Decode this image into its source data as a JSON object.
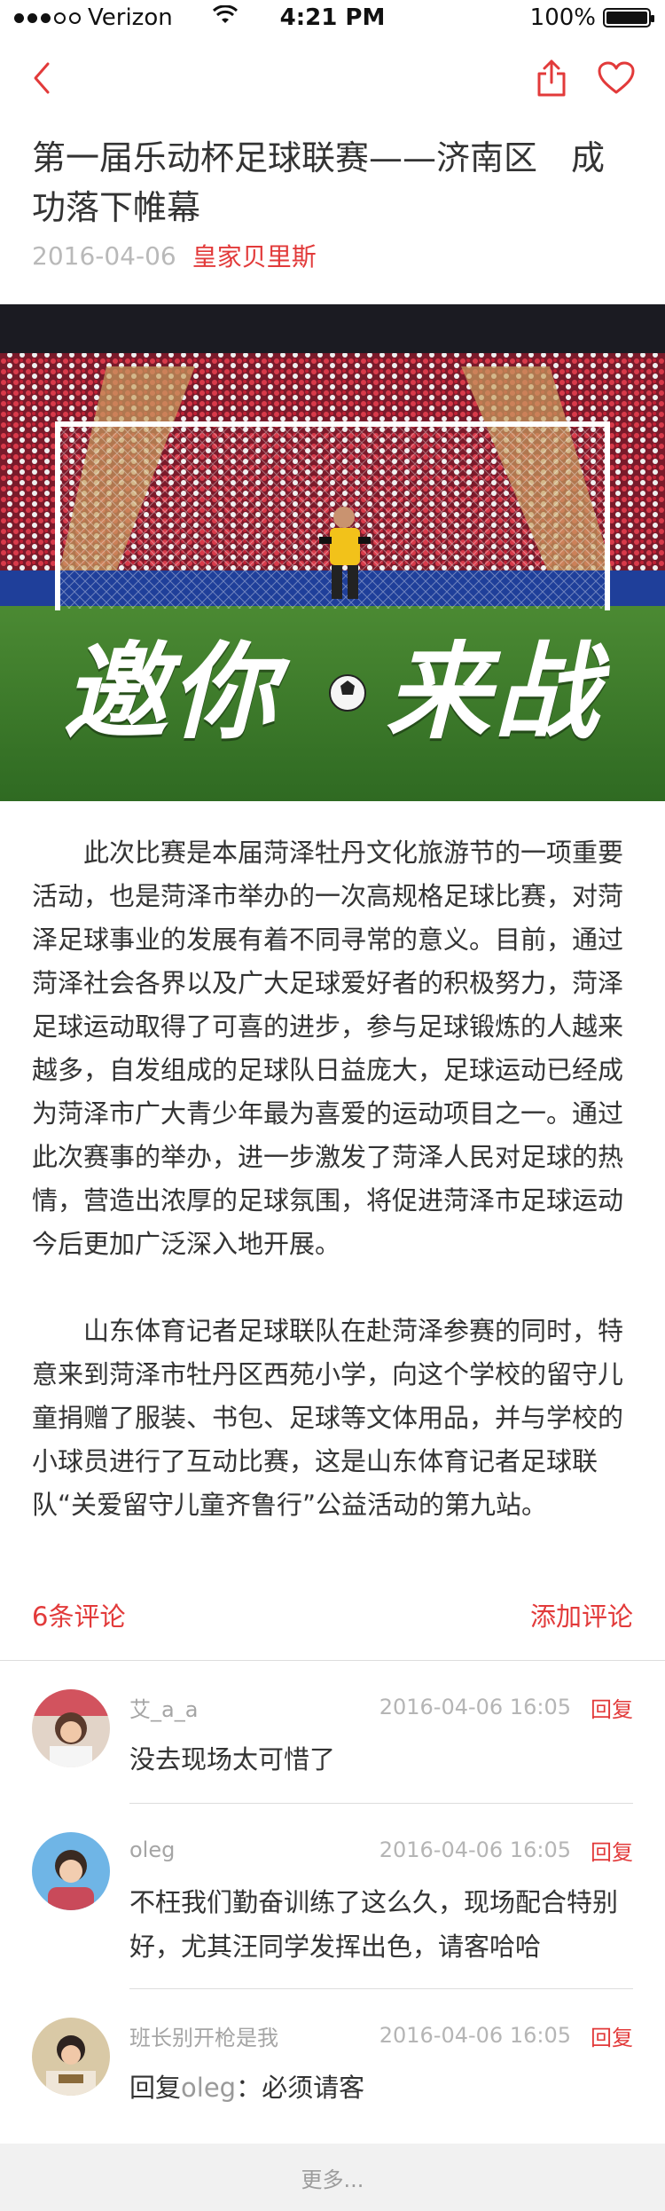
{
  "status_bar": {
    "carrier": "Verizon",
    "time": "4:21 PM",
    "battery": "100%"
  },
  "nav": {
    "back_icon": "chevron-left-icon",
    "share_icon": "share-icon",
    "like_icon": "heart-icon"
  },
  "article": {
    "title": "第一届乐动杯足球联赛——济南区　成功落下帷幕",
    "date": "2016-04-06",
    "author": "皇家贝里斯",
    "hero_slogan_left": "邀你",
    "hero_slogan_right": "来战",
    "paragraphs": [
      "此次比赛是本届菏泽牡丹文化旅游节的一项重要活动，也是菏泽市举办的一次高规格足球比赛，对菏泽足球事业的发展有着不同寻常的意义。目前，通过菏泽社会各界以及广大足球爱好者的积极努力，菏泽足球运动取得了可喜的进步，参与足球锻炼的人越来越多，自发组成的足球队日益庞大，足球运动已经成为菏泽市广大青少年最为喜爱的运动项目之一。通过此次赛事的举办，进一步激发了菏泽人民对足球的热情，营造出浓厚的足球氛围，将促进菏泽市足球运动今后更加广泛深入地开展。",
      "山东体育记者足球联队在赴菏泽参赛的同时，特意来到菏泽市牡丹区西苑小学，向这个学校的留守儿童捐赠了服装、书包、足球等文体用品，并与学校的小球员进行了互动比赛，这是山东体育记者足球联队“关爱留守儿童齐鲁行”公益活动的第九站。"
    ]
  },
  "comments": {
    "count_label": "6条评论",
    "add_label": "添加评论",
    "reply_label": "回复",
    "items": [
      {
        "name": "艾_a_a",
        "time": "2016-04-06  16:05",
        "text": "没去现场太可惜了"
      },
      {
        "name": "oleg",
        "time": "2016-04-06  16:05",
        "text": "不枉我们勤奋训练了这么久，现场配合特别好，尤其汪同学发挥出色，请客哈哈"
      },
      {
        "name": "班长别开枪是我",
        "time": "2016-04-06  16:05",
        "text_prefix": "回复",
        "text_mention": "oleg",
        "text_suffix": "：必须请客"
      }
    ],
    "more_label": "更多..."
  },
  "colors": {
    "accent": "#e23a3a",
    "grass": "#3d7a2a",
    "crowd": "#b7283c"
  }
}
